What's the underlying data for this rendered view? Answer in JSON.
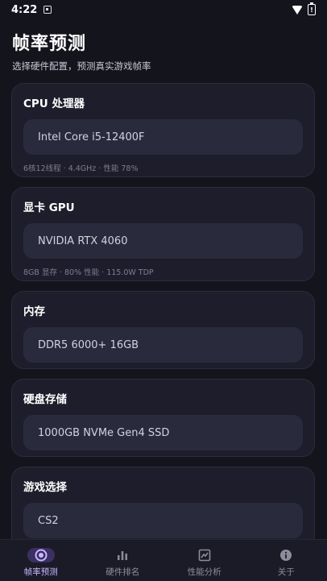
{
  "status": {
    "time": "4:22",
    "battery": "!"
  },
  "header": {
    "title": "帧率预测",
    "subtitle": "选择硬件配置，预测真实游戏帧率"
  },
  "cards": {
    "cpu": {
      "title": "CPU 处理器",
      "value": "Intel Core i5-12400F",
      "note": "6核12线程 · 4.4GHz · 性能 78%"
    },
    "gpu": {
      "title": "显卡 GPU",
      "value": "NVIDIA RTX 4060",
      "note": "8GB 显存 · 80% 性能 · 115.0W TDP"
    },
    "ram": {
      "title": "内存",
      "value": "DDR5 6000+ 16GB"
    },
    "disk": {
      "title": "硬盘存储",
      "value": "1000GB NVMe Gen4 SSD"
    },
    "game": {
      "title": "游戏选择",
      "value": "CS2"
    }
  },
  "nav": {
    "items": [
      {
        "label": "帧率预测",
        "icon": "target-icon"
      },
      {
        "label": "硬件排名",
        "icon": "bar-chart-icon"
      },
      {
        "label": "性能分析",
        "icon": "analytics-icon"
      },
      {
        "label": "关于",
        "icon": "info-icon"
      }
    ]
  },
  "colors": {
    "accent": "#c9b8ff",
    "background": "#14141d",
    "card": "#1d1d2b",
    "field": "#2a2a3d"
  }
}
